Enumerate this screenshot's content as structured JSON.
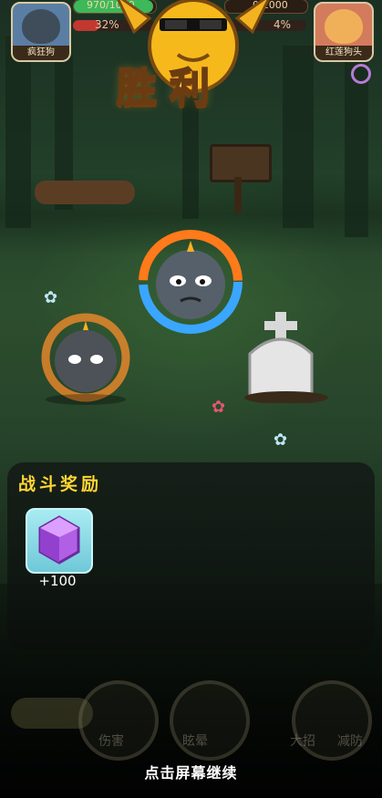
{
  "top_hud": {
    "left_player": {
      "name": "疯狂狗",
      "hp_text": "970/1000",
      "hp_fraction": 0.97,
      "energy_percent_text": "32%"
    },
    "right_player": {
      "name": "红莲狗头",
      "hp_text": "0/1000",
      "hp_fraction": 0.0,
      "energy_percent_text": "4%"
    }
  },
  "result": {
    "title": "胜利"
  },
  "reward_panel": {
    "title": "战斗奖励",
    "items": [
      {
        "icon": "purple-gem-icon",
        "amount": "+100"
      }
    ]
  },
  "background_controls": {
    "labels": [
      "伤害",
      "眩晕",
      "大招",
      "减防"
    ]
  },
  "footer": {
    "hint": "点击屏幕继续"
  },
  "colors": {
    "accent_gold": "#ffd633",
    "hp_green": "#3db85a",
    "energy_red": "#c0382f"
  }
}
